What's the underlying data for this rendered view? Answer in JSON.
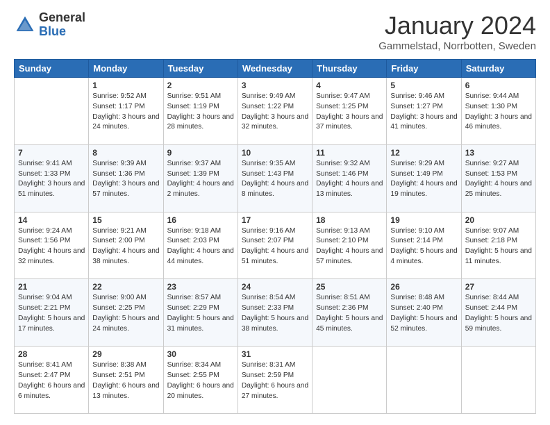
{
  "logo": {
    "general": "General",
    "blue": "Blue"
  },
  "header": {
    "month": "January 2024",
    "location": "Gammelstad, Norrbotten, Sweden"
  },
  "weekdays": [
    "Sunday",
    "Monday",
    "Tuesday",
    "Wednesday",
    "Thursday",
    "Friday",
    "Saturday"
  ],
  "weeks": [
    [
      {
        "day": "",
        "sunrise": "",
        "sunset": "",
        "daylight": ""
      },
      {
        "day": "1",
        "sunrise": "Sunrise: 9:52 AM",
        "sunset": "Sunset: 1:17 PM",
        "daylight": "Daylight: 3 hours and 24 minutes."
      },
      {
        "day": "2",
        "sunrise": "Sunrise: 9:51 AM",
        "sunset": "Sunset: 1:19 PM",
        "daylight": "Daylight: 3 hours and 28 minutes."
      },
      {
        "day": "3",
        "sunrise": "Sunrise: 9:49 AM",
        "sunset": "Sunset: 1:22 PM",
        "daylight": "Daylight: 3 hours and 32 minutes."
      },
      {
        "day": "4",
        "sunrise": "Sunrise: 9:47 AM",
        "sunset": "Sunset: 1:25 PM",
        "daylight": "Daylight: 3 hours and 37 minutes."
      },
      {
        "day": "5",
        "sunrise": "Sunrise: 9:46 AM",
        "sunset": "Sunset: 1:27 PM",
        "daylight": "Daylight: 3 hours and 41 minutes."
      },
      {
        "day": "6",
        "sunrise": "Sunrise: 9:44 AM",
        "sunset": "Sunset: 1:30 PM",
        "daylight": "Daylight: 3 hours and 46 minutes."
      }
    ],
    [
      {
        "day": "7",
        "sunrise": "Sunrise: 9:41 AM",
        "sunset": "Sunset: 1:33 PM",
        "daylight": "Daylight: 3 hours and 51 minutes."
      },
      {
        "day": "8",
        "sunrise": "Sunrise: 9:39 AM",
        "sunset": "Sunset: 1:36 PM",
        "daylight": "Daylight: 3 hours and 57 minutes."
      },
      {
        "day": "9",
        "sunrise": "Sunrise: 9:37 AM",
        "sunset": "Sunset: 1:39 PM",
        "daylight": "Daylight: 4 hours and 2 minutes."
      },
      {
        "day": "10",
        "sunrise": "Sunrise: 9:35 AM",
        "sunset": "Sunset: 1:43 PM",
        "daylight": "Daylight: 4 hours and 8 minutes."
      },
      {
        "day": "11",
        "sunrise": "Sunrise: 9:32 AM",
        "sunset": "Sunset: 1:46 PM",
        "daylight": "Daylight: 4 hours and 13 minutes."
      },
      {
        "day": "12",
        "sunrise": "Sunrise: 9:29 AM",
        "sunset": "Sunset: 1:49 PM",
        "daylight": "Daylight: 4 hours and 19 minutes."
      },
      {
        "day": "13",
        "sunrise": "Sunrise: 9:27 AM",
        "sunset": "Sunset: 1:53 PM",
        "daylight": "Daylight: 4 hours and 25 minutes."
      }
    ],
    [
      {
        "day": "14",
        "sunrise": "Sunrise: 9:24 AM",
        "sunset": "Sunset: 1:56 PM",
        "daylight": "Daylight: 4 hours and 32 minutes."
      },
      {
        "day": "15",
        "sunrise": "Sunrise: 9:21 AM",
        "sunset": "Sunset: 2:00 PM",
        "daylight": "Daylight: 4 hours and 38 minutes."
      },
      {
        "day": "16",
        "sunrise": "Sunrise: 9:18 AM",
        "sunset": "Sunset: 2:03 PM",
        "daylight": "Daylight: 4 hours and 44 minutes."
      },
      {
        "day": "17",
        "sunrise": "Sunrise: 9:16 AM",
        "sunset": "Sunset: 2:07 PM",
        "daylight": "Daylight: 4 hours and 51 minutes."
      },
      {
        "day": "18",
        "sunrise": "Sunrise: 9:13 AM",
        "sunset": "Sunset: 2:10 PM",
        "daylight": "Daylight: 4 hours and 57 minutes."
      },
      {
        "day": "19",
        "sunrise": "Sunrise: 9:10 AM",
        "sunset": "Sunset: 2:14 PM",
        "daylight": "Daylight: 5 hours and 4 minutes."
      },
      {
        "day": "20",
        "sunrise": "Sunrise: 9:07 AM",
        "sunset": "Sunset: 2:18 PM",
        "daylight": "Daylight: 5 hours and 11 minutes."
      }
    ],
    [
      {
        "day": "21",
        "sunrise": "Sunrise: 9:04 AM",
        "sunset": "Sunset: 2:21 PM",
        "daylight": "Daylight: 5 hours and 17 minutes."
      },
      {
        "day": "22",
        "sunrise": "Sunrise: 9:00 AM",
        "sunset": "Sunset: 2:25 PM",
        "daylight": "Daylight: 5 hours and 24 minutes."
      },
      {
        "day": "23",
        "sunrise": "Sunrise: 8:57 AM",
        "sunset": "Sunset: 2:29 PM",
        "daylight": "Daylight: 5 hours and 31 minutes."
      },
      {
        "day": "24",
        "sunrise": "Sunrise: 8:54 AM",
        "sunset": "Sunset: 2:33 PM",
        "daylight": "Daylight: 5 hours and 38 minutes."
      },
      {
        "day": "25",
        "sunrise": "Sunrise: 8:51 AM",
        "sunset": "Sunset: 2:36 PM",
        "daylight": "Daylight: 5 hours and 45 minutes."
      },
      {
        "day": "26",
        "sunrise": "Sunrise: 8:48 AM",
        "sunset": "Sunset: 2:40 PM",
        "daylight": "Daylight: 5 hours and 52 minutes."
      },
      {
        "day": "27",
        "sunrise": "Sunrise: 8:44 AM",
        "sunset": "Sunset: 2:44 PM",
        "daylight": "Daylight: 5 hours and 59 minutes."
      }
    ],
    [
      {
        "day": "28",
        "sunrise": "Sunrise: 8:41 AM",
        "sunset": "Sunset: 2:47 PM",
        "daylight": "Daylight: 6 hours and 6 minutes."
      },
      {
        "day": "29",
        "sunrise": "Sunrise: 8:38 AM",
        "sunset": "Sunset: 2:51 PM",
        "daylight": "Daylight: 6 hours and 13 minutes."
      },
      {
        "day": "30",
        "sunrise": "Sunrise: 8:34 AM",
        "sunset": "Sunset: 2:55 PM",
        "daylight": "Daylight: 6 hours and 20 minutes."
      },
      {
        "day": "31",
        "sunrise": "Sunrise: 8:31 AM",
        "sunset": "Sunset: 2:59 PM",
        "daylight": "Daylight: 6 hours and 27 minutes."
      },
      {
        "day": "",
        "sunrise": "",
        "sunset": "",
        "daylight": ""
      },
      {
        "day": "",
        "sunrise": "",
        "sunset": "",
        "daylight": ""
      },
      {
        "day": "",
        "sunrise": "",
        "sunset": "",
        "daylight": ""
      }
    ]
  ]
}
